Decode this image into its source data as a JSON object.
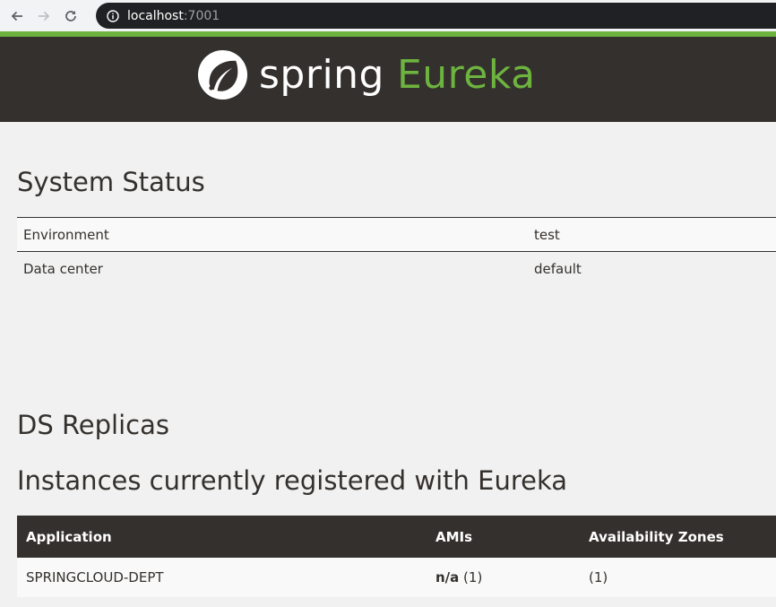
{
  "browser": {
    "url_host": "localhost",
    "url_port": ":7001"
  },
  "header": {
    "logo_word1": "spring",
    "logo_word2": "Eureka"
  },
  "system_status": {
    "title": "System Status",
    "rows": [
      {
        "label": "Environment",
        "value": "test"
      },
      {
        "label": "Data center",
        "value": "default"
      }
    ]
  },
  "ds_replicas": {
    "title": "DS Replicas"
  },
  "instances": {
    "title": "Instances currently registered with Eureka",
    "columns": [
      "Application",
      "AMIs",
      "Availability Zones"
    ],
    "rows": [
      {
        "application": "SPRINGCLOUD-DEPT",
        "ami_value": "n/a",
        "ami_count": " (1)",
        "zones": "(1)"
      }
    ]
  },
  "colors": {
    "brand_green": "#6db33f",
    "header_bg": "#34302d",
    "page_bg": "#f1f1f1"
  },
  "icons": [
    "back-arrow-icon",
    "forward-arrow-icon",
    "reload-icon",
    "info-icon",
    "spring-leaf-icon"
  ]
}
